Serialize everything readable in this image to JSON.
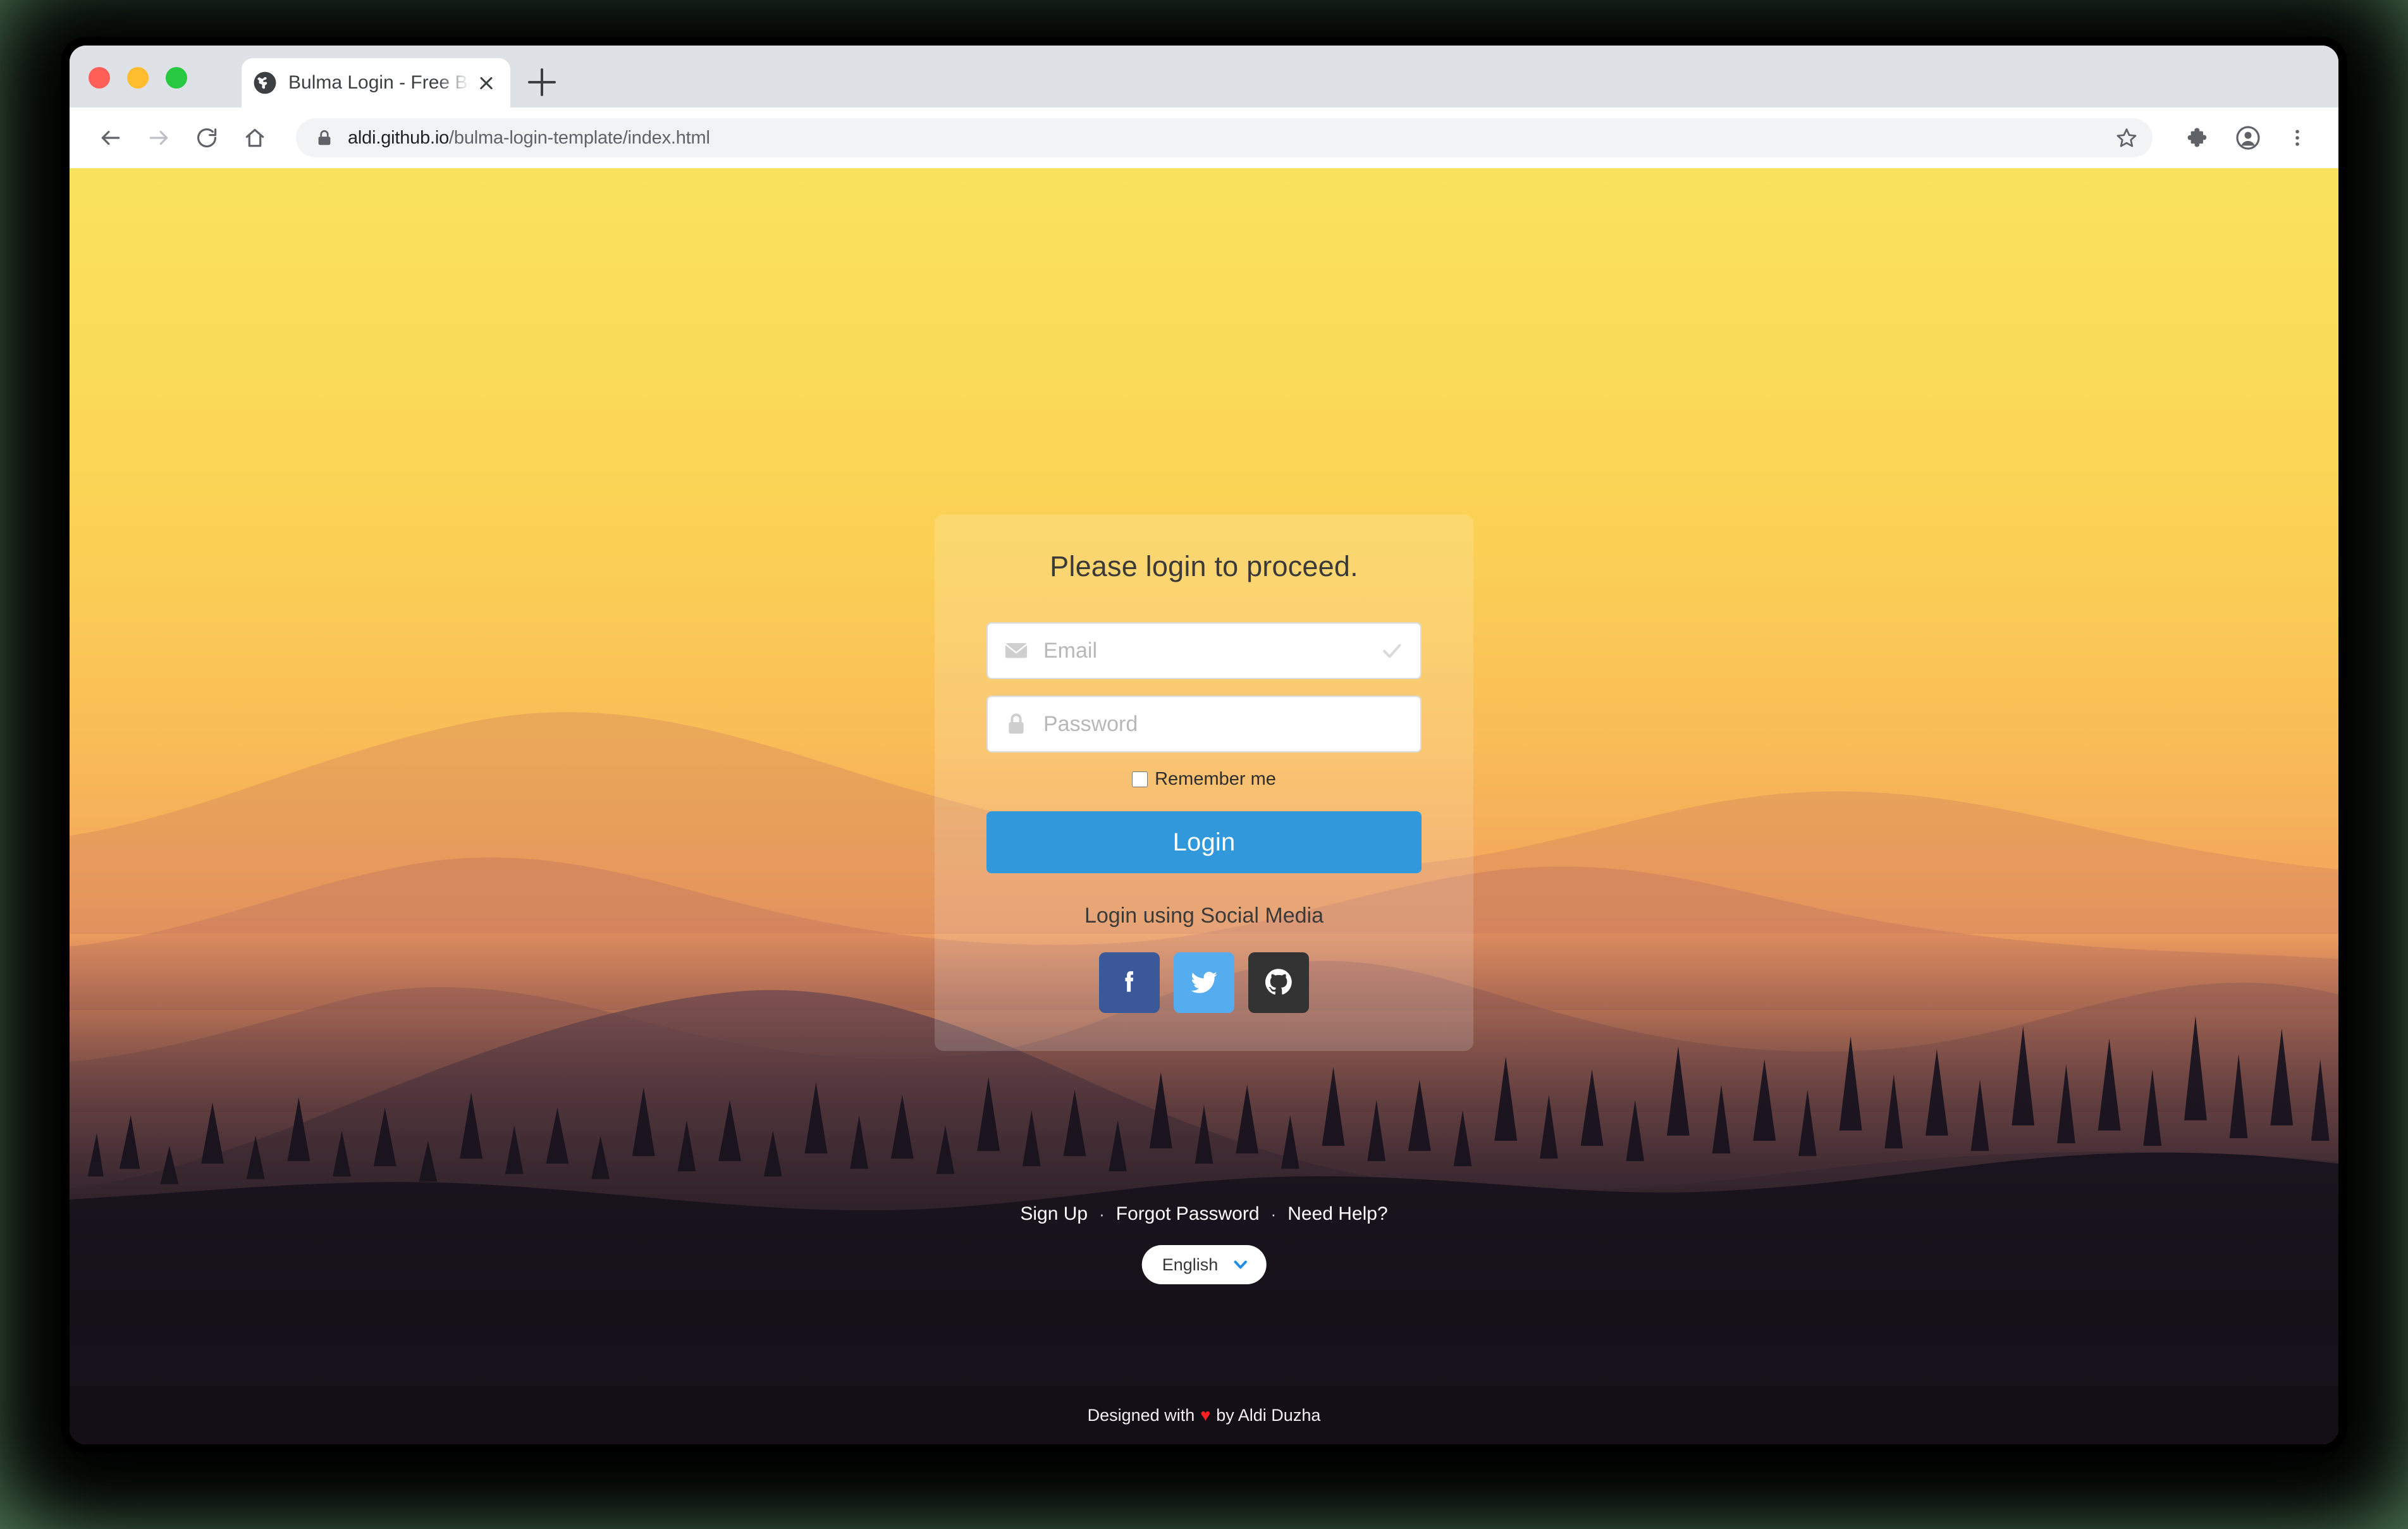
{
  "browser": {
    "tab": {
      "title": "Bulma Login - Free Bulma Temp",
      "favicon": "globe-icon",
      "close": "close-icon",
      "new_tab": "new-tab-icon"
    },
    "nav": {
      "back": "back-arrow-icon",
      "forward": "forward-arrow-icon",
      "reload": "reload-icon",
      "home": "home-icon"
    },
    "omnibox": {
      "lock": "lock-icon",
      "url_host": "aldi.github.io",
      "url_path": "/bulma-login-template/index.html",
      "url_full": "aldi.github.io/bulma-login-template/index.html",
      "star": "star-icon"
    },
    "toolbar_icons": {
      "extensions": "puzzle-piece-icon",
      "profile": "account-circle-icon",
      "menu": "three-dot-menu-icon"
    }
  },
  "page": {
    "card": {
      "title": "Please login to proceed.",
      "email": {
        "placeholder": "Email",
        "value": "",
        "left_icon": "envelope-icon",
        "right_icon": "check-icon"
      },
      "password": {
        "placeholder": "Password",
        "value": "",
        "left_icon": "lock-icon"
      },
      "remember": {
        "label": "Remember me",
        "checked": false
      },
      "login_button": "Login",
      "social_title": "Login using Social Media",
      "social_buttons": [
        {
          "name": "facebook",
          "icon": "facebook-icon",
          "color": "#3b5998"
        },
        {
          "name": "twitter",
          "icon": "twitter-icon",
          "color": "#55acee"
        },
        {
          "name": "github",
          "icon": "github-icon",
          "color": "#333333"
        }
      ]
    },
    "links": [
      {
        "label": "Sign Up"
      },
      {
        "label": "Forgot Password"
      },
      {
        "label": "Need Help?"
      }
    ],
    "link_separator": "·",
    "language_select": {
      "value": "English",
      "chevron": "chevron-down-icon",
      "chevron_color": "#1f8fe5"
    },
    "footer": {
      "prefix": "Designed with",
      "heart": "♥",
      "suffix": "by Aldi Duzha"
    }
  },
  "colors": {
    "accent_button": "#3298dc",
    "sky_top": "#fae25c",
    "sky_mid": "#f2a55c",
    "ground": "#16121b",
    "desktop": "#4a7050",
    "traffic_red": "#ff5f57",
    "traffic_yellow": "#febc2e",
    "traffic_green": "#28c840"
  }
}
